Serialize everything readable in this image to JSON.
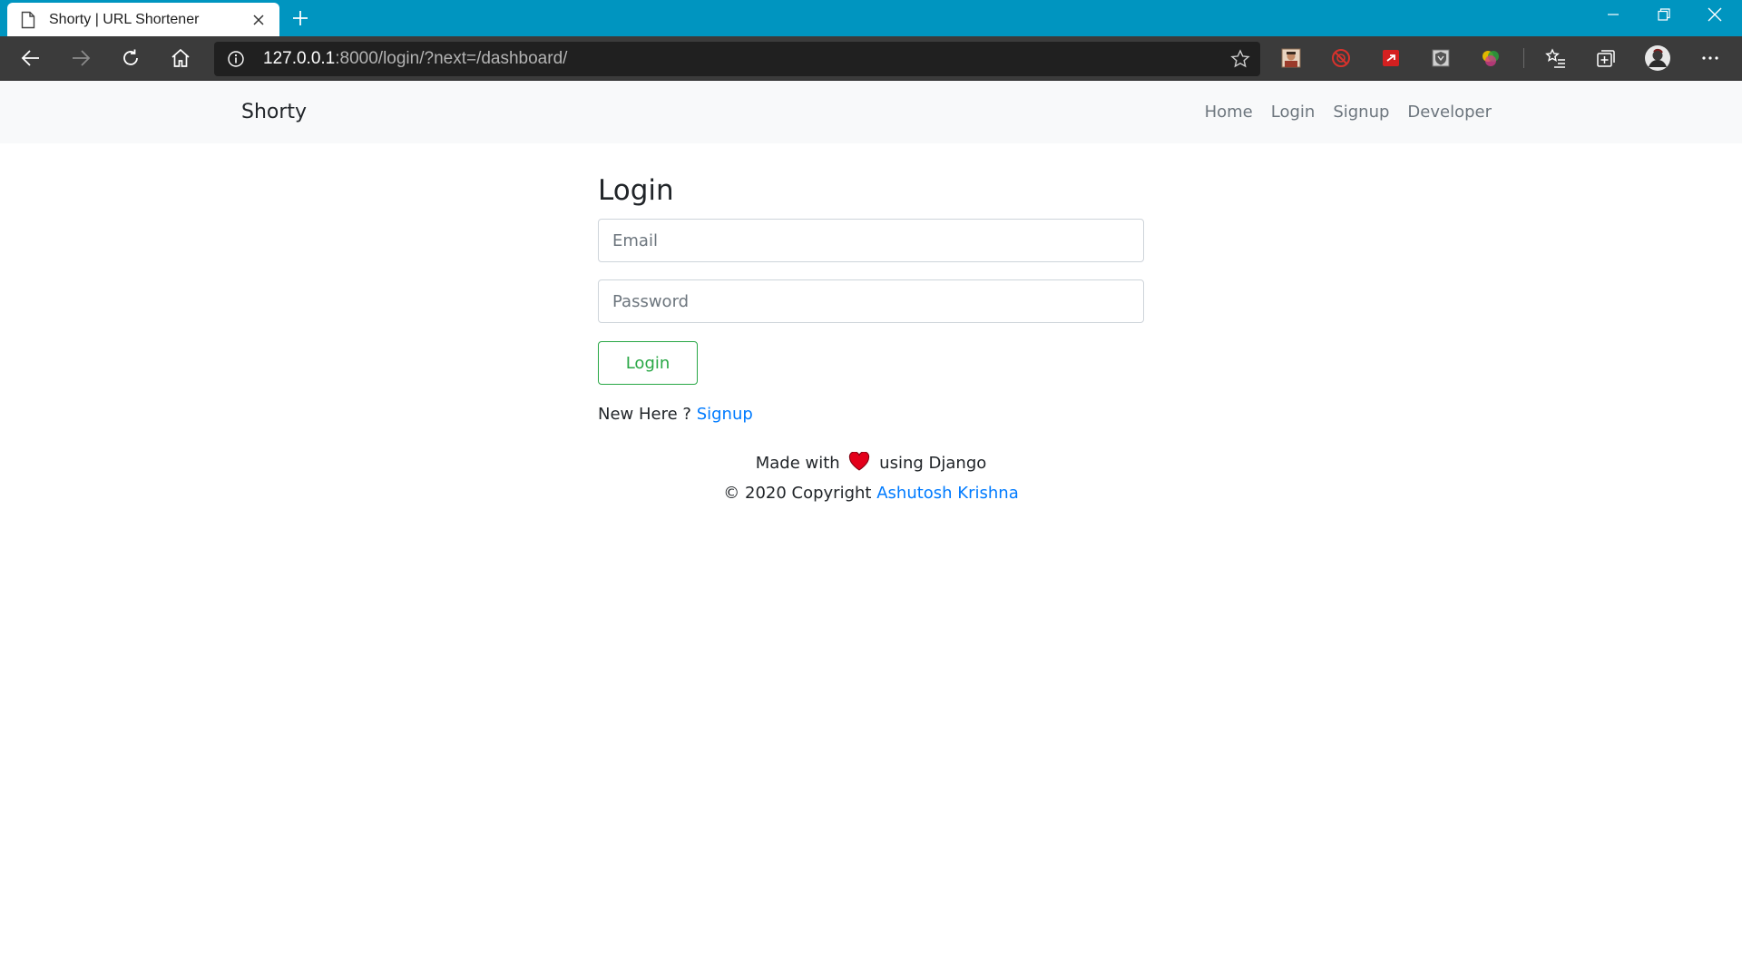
{
  "browser": {
    "tab_title": "Shorty | URL Shortener",
    "address_host": "127.0.0.1",
    "address_path": ":8000/login/?next=/dashboard/",
    "extensions": [
      "profile-photo-extension-icon",
      "adblock-extension-icon",
      "red-extension-icon",
      "shield-extension-icon",
      "color-extension-icon"
    ],
    "accent_color": "#0095c0"
  },
  "navbar": {
    "brand": "Shorty",
    "links": [
      "Home",
      "Login",
      "Signup",
      "Developer"
    ]
  },
  "login": {
    "heading": "Login",
    "email_placeholder": "Email",
    "password_placeholder": "Password",
    "button_label": "Login",
    "new_here_text": "New Here ?",
    "signup_link": "Signup"
  },
  "footer": {
    "made_with": "Made with",
    "using": "using Django",
    "copyright": "© 2020 Copyright",
    "author": "Ashutosh Krishna"
  },
  "colors": {
    "link": "#007bff",
    "success": "#28a745",
    "heart": "#e3001b"
  }
}
